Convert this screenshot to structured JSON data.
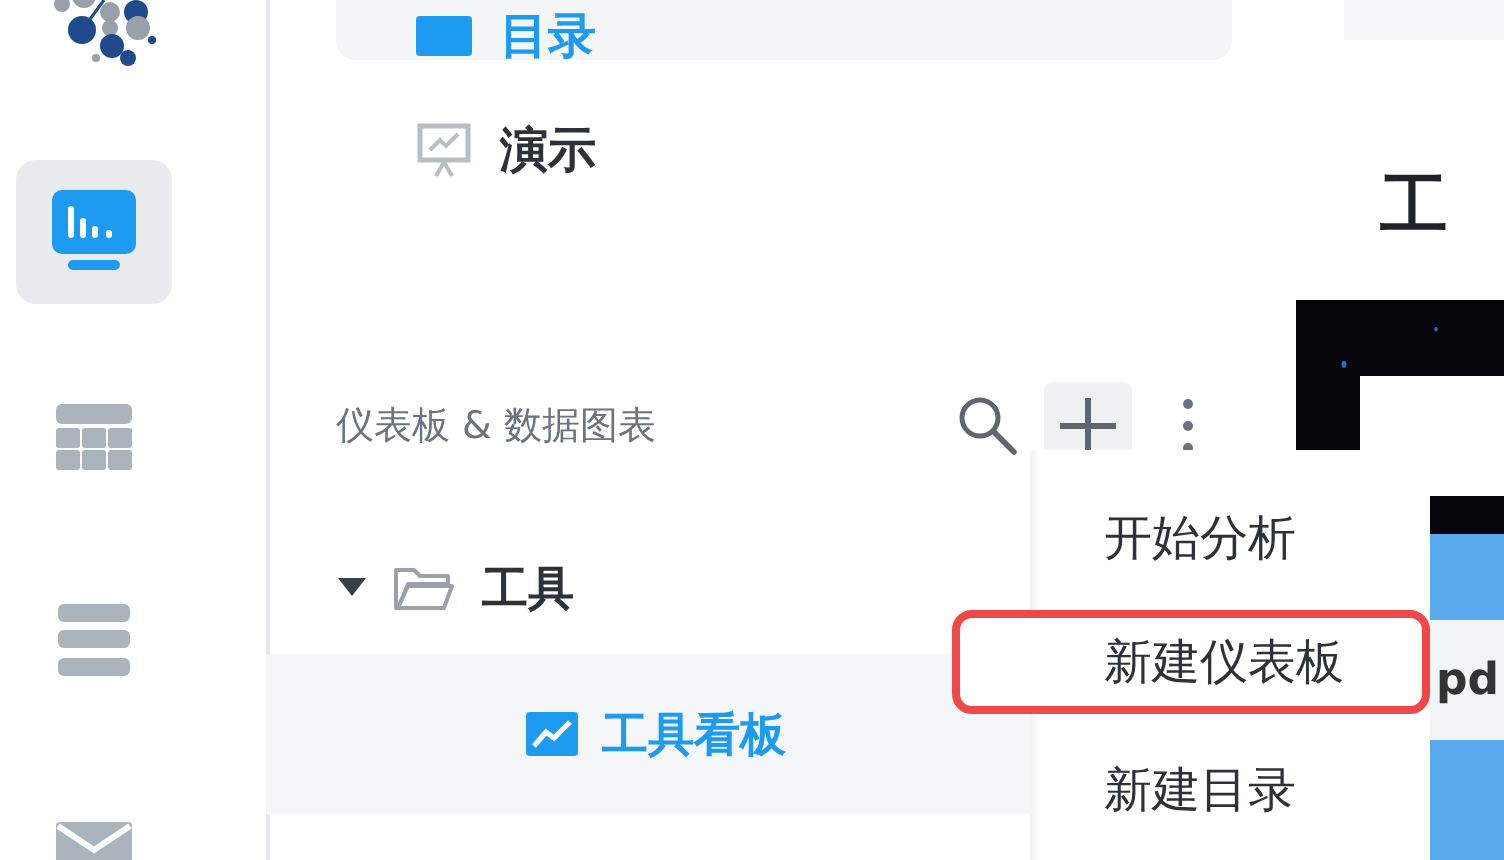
{
  "rail": {
    "items": [
      {
        "kind": "dashboard",
        "selected": true
      },
      {
        "kind": "table",
        "selected": false
      },
      {
        "kind": "list",
        "selected": false
      },
      {
        "kind": "mail",
        "selected": false
      }
    ]
  },
  "nav": {
    "items": [
      {
        "label": "目录",
        "kind": "catalog",
        "selected": true
      },
      {
        "label": "演示",
        "kind": "presentation",
        "selected": false
      }
    ]
  },
  "section": {
    "title": "仪表板 & 数据图表"
  },
  "tree": [
    {
      "label": "工具",
      "expanded": true,
      "children": [
        {
          "label": "工具看板",
          "selected": true
        }
      ]
    }
  ],
  "menu": {
    "items": [
      {
        "label": "开始分析",
        "highlighted": false
      },
      {
        "label": "新建仪表板",
        "highlighted": true
      },
      {
        "label": "新建目录",
        "highlighted": false
      }
    ]
  },
  "content": {
    "title": "工",
    "row_2": "pd"
  }
}
